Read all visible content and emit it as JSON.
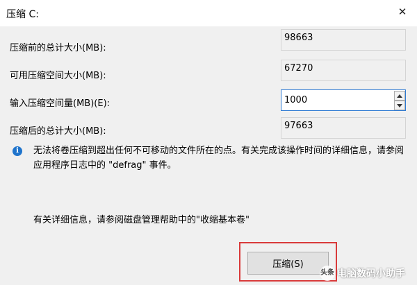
{
  "window": {
    "title": "压缩 C:",
    "close_glyph": "✕"
  },
  "fields": {
    "total_before": {
      "label": "压缩前的总计大小(MB):",
      "value": "98663"
    },
    "available": {
      "label": "可用压缩空间大小(MB):",
      "value": "67270"
    },
    "shrink_amount": {
      "label": "输入压缩空间量(MB)(E):",
      "value": "1000"
    },
    "total_after": {
      "label": "压缩后的总计大小(MB):",
      "value": "97663"
    }
  },
  "info": {
    "icon": "i",
    "text": "无法将卷压缩到超出任何不可移动的文件所在的点。有关完成该操作时间的详细信息，请参阅应用程序日志中的 \"defrag\" 事件。"
  },
  "help": {
    "text": "有关详细信息，请参阅磁盘管理帮助中的\"收缩基本卷\""
  },
  "buttons": {
    "shrink_label": "压缩(S)"
  },
  "watermark": {
    "text": "电脑数码小助手",
    "logo_text": "头条"
  },
  "colors": {
    "highlight": "#d93a3a",
    "focus_border": "#2f7bd3",
    "info_icon": "#1f74cc"
  }
}
